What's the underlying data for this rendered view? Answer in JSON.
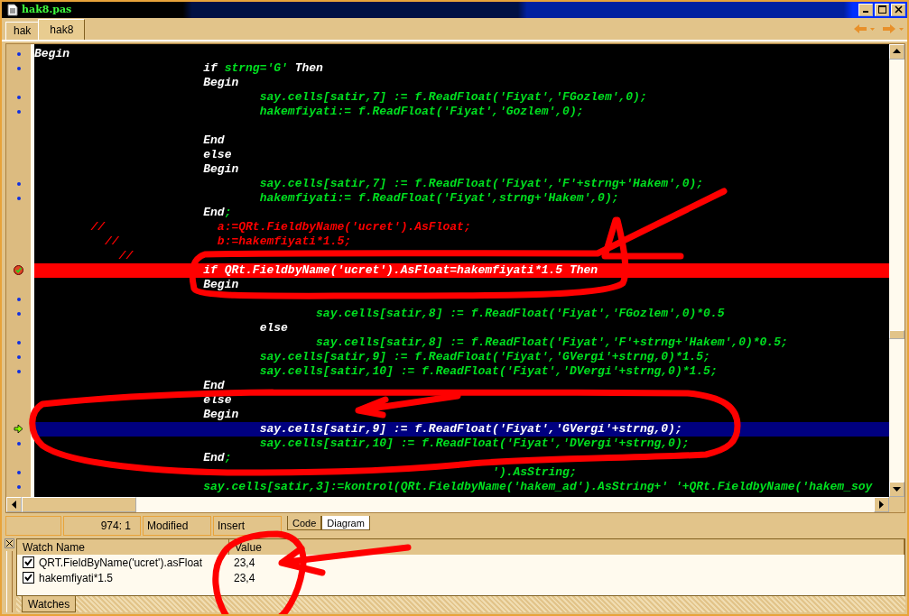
{
  "window": {
    "title": "hak8.pas"
  },
  "tabs": [
    {
      "label": "hak",
      "selected": false
    },
    {
      "label": "hak8",
      "selected": true
    }
  ],
  "editor": {
    "lines": [
      {
        "kind": "normal",
        "marker": true,
        "parts": [
          {
            "kind": "kw",
            "text": "Begin"
          }
        ]
      },
      {
        "kind": "normal",
        "marker": true,
        "parts": [
          {
            "kind": "kw",
            "text": "                        if "
          },
          {
            "kind": "code",
            "text": "strng='G' "
          },
          {
            "kind": "kw",
            "text": "Then"
          }
        ]
      },
      {
        "kind": "normal",
        "marker": false,
        "parts": [
          {
            "kind": "kw",
            "text": "                        Begin"
          }
        ]
      },
      {
        "kind": "normal",
        "marker": true,
        "parts": [
          {
            "kind": "code",
            "text": "                                say.cells[satir,7] := f.ReadFloat('Fiyat','FGozlem',0);"
          }
        ]
      },
      {
        "kind": "normal",
        "marker": true,
        "parts": [
          {
            "kind": "code",
            "text": "                                hakemfiyati:= f.ReadFloat('Fiyat','Gozlem',0);"
          }
        ]
      },
      {
        "kind": "normal",
        "marker": false
      },
      {
        "kind": "normal",
        "marker": false,
        "parts": [
          {
            "kind": "kw",
            "text": "                        End"
          }
        ]
      },
      {
        "kind": "normal",
        "marker": false,
        "parts": [
          {
            "kind": "kw",
            "text": "                        else"
          }
        ]
      },
      {
        "kind": "normal",
        "marker": false,
        "parts": [
          {
            "kind": "kw",
            "text": "                        Begin"
          }
        ]
      },
      {
        "kind": "normal",
        "marker": true,
        "parts": [
          {
            "kind": "code",
            "text": "                                say.cells[satir,7] := f.ReadFloat('Fiyat','F'+strng+'Hakem',0);"
          }
        ]
      },
      {
        "kind": "normal",
        "marker": true,
        "parts": [
          {
            "kind": "code",
            "text": "                                hakemfiyati:= f.ReadFloat('Fiyat',strng+'Hakem',0);"
          }
        ]
      },
      {
        "kind": "normal",
        "marker": false,
        "parts": [
          {
            "kind": "kw",
            "text": "                        End"
          },
          {
            "kind": "code",
            "text": ";"
          }
        ]
      },
      {
        "kind": "normal",
        "marker": false,
        "parts": [
          {
            "kind": "comment",
            "text": "        //                a:=QRt.FieldbyName('ucret').AsFloat;"
          }
        ]
      },
      {
        "kind": "normal",
        "marker": false,
        "parts": [
          {
            "kind": "comment",
            "text": "          //              b:=hakemfiyati*1.5;"
          }
        ]
      },
      {
        "kind": "normal",
        "marker": false,
        "parts": [
          {
            "kind": "comment",
            "text": "            //"
          }
        ]
      },
      {
        "kind": "breakpoint",
        "marker": false,
        "parts": [
          {
            "kind": "kw",
            "text": "                        if QRt.FieldbyName('ucret').AsFloat=hakemfiyati*1.5 Then"
          }
        ]
      },
      {
        "kind": "normal",
        "marker": false,
        "parts": [
          {
            "kind": "kw",
            "text": "                        Begin"
          }
        ]
      },
      {
        "kind": "normal",
        "marker": true
      },
      {
        "kind": "normal",
        "marker": true,
        "parts": [
          {
            "kind": "code",
            "text": "                                        say.cells[satir,8] := f.ReadFloat('Fiyat','FGozlem',0)*0.5"
          }
        ]
      },
      {
        "kind": "normal",
        "marker": false,
        "parts": [
          {
            "kind": "kw",
            "text": "                                else"
          }
        ]
      },
      {
        "kind": "normal",
        "marker": true,
        "parts": [
          {
            "kind": "code",
            "text": "                                        say.cells[satir,8] := f.ReadFloat('Fiyat','F'+strng+'Hakem',0)*0.5;"
          }
        ]
      },
      {
        "kind": "normal",
        "marker": true,
        "parts": [
          {
            "kind": "code",
            "text": "                                say.cells[satir,9] := f.ReadFloat('Fiyat','GVergi'+strng,0)*1.5;"
          }
        ]
      },
      {
        "kind": "normal",
        "marker": true,
        "parts": [
          {
            "kind": "code",
            "text": "                                say.cells[satir,10] := f.ReadFloat('Fiyat','DVergi'+strng,0)*1.5;"
          }
        ]
      },
      {
        "kind": "normal",
        "marker": false,
        "parts": [
          {
            "kind": "kw",
            "text": "                        End"
          }
        ]
      },
      {
        "kind": "normal",
        "marker": false,
        "parts": [
          {
            "kind": "kw",
            "text": "                        else"
          }
        ]
      },
      {
        "kind": "normal",
        "marker": false,
        "parts": [
          {
            "kind": "kw",
            "text": "                        Begin"
          }
        ]
      },
      {
        "kind": "execution",
        "marker": false,
        "parts": [
          {
            "kind": "kw",
            "text": "                                say.cells[satir,9] := f.ReadFloat('Fiyat','GVergi'+strng,0);"
          }
        ]
      },
      {
        "kind": "normal",
        "marker": true,
        "parts": [
          {
            "kind": "code",
            "text": "                                say.cells[satir,10] := f.ReadFloat('Fiyat','DVergi'+strng,0);"
          }
        ]
      },
      {
        "kind": "normal",
        "marker": false,
        "parts": [
          {
            "kind": "kw",
            "text": "                        End"
          },
          {
            "kind": "code",
            "text": ";"
          }
        ]
      },
      {
        "kind": "normal",
        "marker": true,
        "parts": [
          {
            "kind": "code",
            "text": "                                                                 ').AsString;"
          }
        ]
      },
      {
        "kind": "normal",
        "marker": true,
        "parts": [
          {
            "kind": "code",
            "text": "                        say.cells[satir,3]:=kontrol(QRt.FieldbyName('hakem_ad').AsString+' '+QRt.FieldbyName('hakem_soy"
          }
        ]
      }
    ]
  },
  "status_bar": {
    "position": "974:  1",
    "modified": "Modified",
    "mode": "Insert",
    "view_tabs": [
      {
        "label": "Code",
        "selected": true
      },
      {
        "label": "Diagram",
        "selected": false
      }
    ]
  },
  "watches": {
    "columns": [
      "Watch Name",
      "Value"
    ],
    "rows": [
      {
        "checked": true,
        "name": "QRT.FieldByName('ucret').asFloat",
        "value": "23,4"
      },
      {
        "checked": true,
        "name": "hakemfiyati*1.5",
        "value": "23,4"
      }
    ],
    "tab": "Watches"
  }
}
